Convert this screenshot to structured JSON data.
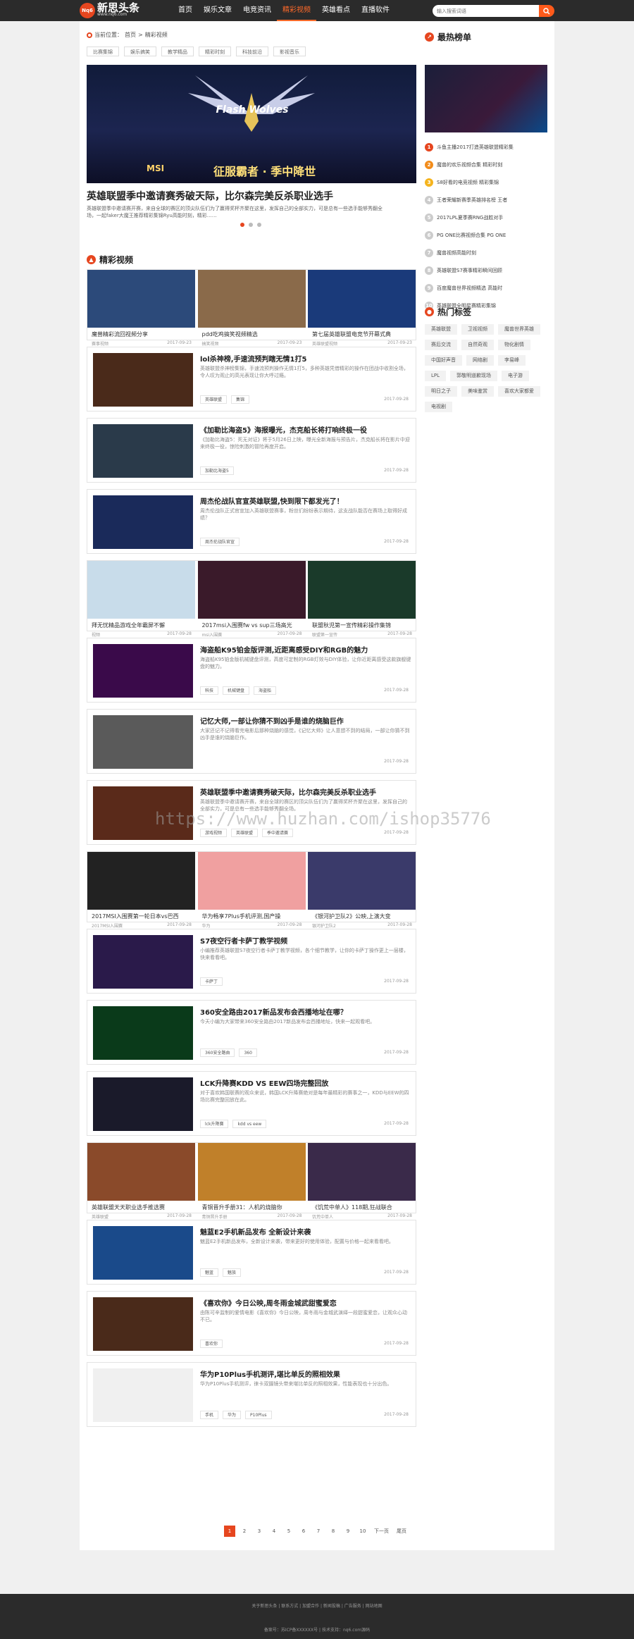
{
  "header": {
    "logo_badge": "Nq6",
    "logo_text": "新思头条",
    "logo_sub": "www.nq6.com",
    "nav": [
      {
        "label": "首页"
      },
      {
        "label": "娱乐文章"
      },
      {
        "label": "电竞资讯"
      },
      {
        "label": "精彩视频",
        "active": true
      },
      {
        "label": "英雄看点"
      },
      {
        "label": "直播软件"
      }
    ],
    "search_placeholder": "输入搜索词语"
  },
  "breadcrumb": {
    "prefix": "当前位置：",
    "home": "首页",
    "sep": " > ",
    "current": "精彩视频"
  },
  "filter_tags": [
    "比赛集锦",
    "娱乐搞笑",
    "教学精品",
    "精彩时刻",
    "科技前沿",
    "影视音乐"
  ],
  "slider": {
    "logo_text": "Flash Wolves",
    "msi": "MSI",
    "slogan": "征服霸者 · 季中降世",
    "title": "英雄联盟季中邀请赛秀破天际，比尔森完美反杀职业选手",
    "desc": "英雄联盟季中邀请赛开赛，来自全球的赛区的顶尖队伍们为了赢得奖杯齐聚在这里，发挥自己的全部实力，可是总有一些选手能够秀翻全场，一起faker大魔王推荐精彩集锦Ryu高能时刻，精彩……"
  },
  "section_title": "精彩视频",
  "cards": [
    {
      "type": "triple",
      "items": [
        {
          "title": "魔兽精彩流回视频分享",
          "tag": "赛事视频",
          "date": "2017-09-23",
          "color": "#2c4a7a"
        },
        {
          "title": "pdd吃鸡搞笑视频精选",
          "tag": "搞笑视频",
          "date": "2017-09-23",
          "color": "#8a6a4a"
        },
        {
          "title": "第七届英雄联盟电竞节开幕式典",
          "tag": "英雄联盟视频",
          "date": "2017-09-23",
          "color": "#1a3a7a"
        }
      ]
    },
    {
      "type": "single",
      "title": "lol杀神榜,手速流预判瞎无情1打5",
      "desc": "英雄联盟杀神榜集锦，手速流预判操作无情1打5，多种英雄凭借精彩的操作在团战中收割全场，令人叹为观止的高光表现让你大呼过瘾。",
      "tags": [
        "英雄联盟",
        "集锦"
      ],
      "date": "2017-09-28",
      "color": "#4a2a1a"
    },
    {
      "type": "single",
      "title": "《加勒比海盗5》海报曝光，杰克船长将打响终极一役",
      "desc": "《加勒比海盗5：死无对证》将于5月26日上映，曝光全新海报与预告片，杰克船长将在影片中迎来终极一役，惊险刺激的冒险再度开启。",
      "tags": [
        "加勒比海盗5"
      ],
      "date": "2017-09-28",
      "color": "#2a3a4a"
    },
    {
      "type": "single",
      "title": "周杰伦战队官宣英雄联盟,快到限下都发光了！",
      "desc": "周杰伦战队正式官宣加入英雄联盟赛事，粉丝们纷纷表示期待，这支战队能否在赛场上取得好成绩？",
      "tags": [
        "周杰伦战队官宣"
      ],
      "date": "2017-09-28",
      "color": "#1a2a5a"
    },
    {
      "type": "triple",
      "items": [
        {
          "title": "拜无忧精品游戏全年霸屏不懈",
          "tag": "视频",
          "date": "2017-09-28",
          "color": "#c8dcea"
        },
        {
          "title": "2017msi入围赛fw vs sup三场高光",
          "tag": "msi入围赛",
          "date": "2017-09-28",
          "color": "#3a1a2a"
        },
        {
          "title": "联盟秋児第一宣传精彩操作集锦",
          "tag": "联盟第一宣传",
          "date": "2017-09-28",
          "color": "#1a3a2a"
        }
      ]
    },
    {
      "type": "single",
      "title": "海盗船K95铂金版评测,近距离感受DIY和RGB的魅力",
      "desc": "海盗船K95铂金版机械键盘评测，高度可定制的RGB灯效与DIY体验，让你近距离感受这款旗舰键盘的魅力。",
      "tags": [
        "科技",
        "机械键盘",
        "海盗船"
      ],
      "date": "2017-09-28",
      "color": "#3a0a4a"
    },
    {
      "type": "single",
      "title": "记忆大师,一部让你猜不到凶手是谁的烧脑巨作",
      "desc": "大家还记不记得看完电影后那种烧脑的感觉，《记忆大师》让人意想不到的结局，一部让你猜不到凶手是谁的烧脑巨作。",
      "tags": [],
      "date": "2017-09-28",
      "color": "#5a5a5a"
    },
    {
      "type": "single",
      "title": "英雄联盟季中邀请赛秀破天际，比尔森完美反杀职业选手",
      "desc": "英雄联盟季中邀请赛开赛，来自全球的赛区的顶尖队伍们为了赢得奖杯齐聚在这里，发挥自己的全部实力，可是总有一些选手能够秀翻全场。",
      "tags": [
        "游戏视频",
        "英雄联盟",
        "季中邀请赛"
      ],
      "date": "2017-09-28",
      "color": "#5a2a1a"
    },
    {
      "type": "triple",
      "items": [
        {
          "title": "2017MSI入围赛第一轮日本vs巴西",
          "tag": "2017MSI入围赛",
          "date": "2017-09-28",
          "color": "#222222"
        },
        {
          "title": "华为畅享7Plus手机评测,国产操",
          "tag": "华为",
          "date": "2017-09-28",
          "color": "#f0a0a0"
        },
        {
          "title": "《银河护卫队2》公映,上演大变",
          "tag": "银河护卫队2",
          "date": "2017-09-28",
          "color": "#3a3a6a"
        }
      ]
    },
    {
      "type": "single",
      "title": "S7夜空行者卡萨丁教学视频",
      "desc": "小编推荐英雄联盟S7夜空行者卡萨丁教学视频，各个细节教学，让你的卡萨丁操作更上一层楼，快来看看吧。",
      "tags": [
        "卡萨丁"
      ],
      "date": "2017-09-28",
      "color": "#2a1a4a"
    },
    {
      "type": "single",
      "title": "360安全路由2017新品发布会西播地址在哪？",
      "desc": "今天小编为大家带来360安全路由2017新品发布会西播地址，快来一起观看吧。",
      "tags": [
        "360安全路由",
        "360"
      ],
      "date": "2017-09-28",
      "color": "#0a3a1a"
    },
    {
      "type": "single",
      "title": "LCK升降赛KDD VS EEW四场完整回放",
      "desc": "对于喜欢韩国联赛的观众来说，韩国LCK升降赛绝对是每年最精彩的赛事之一，KDD与EEW的四场比赛完整回放在此。",
      "tags": [
        "lck升降赛",
        "kdd vs eew"
      ],
      "date": "2017-09-28",
      "color": "#1a1a2a"
    },
    {
      "type": "triple",
      "items": [
        {
          "title": "英雄联盟天天职业选手推选赛",
          "tag": "英雄联盟",
          "date": "2017-09-28",
          "color": "#8a4a2a"
        },
        {
          "title": "青铜晋升手册31：人机的烧脑你",
          "tag": "青铜晋升手册",
          "date": "2017-09-28",
          "color": "#c0802a"
        },
        {
          "title": "《饥荒中单人》118期,狂战联合",
          "tag": "饥荒中单人",
          "date": "2017-09-28",
          "color": "#3a2a4a"
        }
      ]
    },
    {
      "type": "single",
      "title": "魅蓝E2手机新品发布 全新设计来袭",
      "desc": "魅蓝E2手机新品发布，全新设计来袭，带来更好的使用体验，配置与价格一起来看看吧。",
      "tags": [
        "魅蓝",
        "魅族"
      ],
      "date": "2017-09-28",
      "color": "#1a4a8a"
    },
    {
      "type": "single",
      "title": "《喜欢你》今日公映,周冬雨金城武甜蜜爱恋",
      "desc": "由陈可辛监制的爱情电影《喜欢你》今日公映，周冬雨与金城武演绎一段甜蜜爱恋，让观众心动不已。",
      "tags": [
        "喜欢你"
      ],
      "date": "2017-09-28",
      "color": "#4a2a1a"
    },
    {
      "type": "single",
      "title": "华为P10Plus手机测评,堪比单反的照相效果",
      "desc": "华为P10Plus手机测评，徕卡双摄镜头带来堪比单反的照相效果，性能表现也十分出色。",
      "tags": [
        "手机",
        "华为",
        "P10Plus"
      ],
      "date": "2017-09-28",
      "color": "#f0f0f0"
    }
  ],
  "sidebar": {
    "hot_title": "最热榜单",
    "hot_list": [
      "斗鱼主播2017打造英雄联盟精彩集",
      "魔兽的欢乐视频合集 精彩时刻",
      "S8好看的电竞视频 精彩集锦",
      "王者荣耀新赛季英雄排名榜 王者",
      "2017LPL夏季赛RNG战胜对手",
      "PG ONE比赛视频合集 PG ONE",
      "魔兽视频高能时刻",
      "英雄联盟S7赛事精彩瞬间回顾",
      "百度魔兽世界视频精选 高能时",
      "英雄联盟全明星赛精彩集锦"
    ],
    "tags_title": "热门标签",
    "tags": [
      "英雄联盟",
      "卫视视频",
      "魔兽世界英雄",
      "赛后交流",
      "自然奇观",
      "物化剧情",
      "中国好声音",
      "网络剧",
      "李易峰",
      "LPL",
      "郭敬明道歉现场",
      "电子游",
      "明日之子",
      "美味鉴赏",
      "喜欢大家都爱",
      "电视剧"
    ]
  },
  "pager": [
    "1",
    "2",
    "3",
    "4",
    "5",
    "6",
    "7",
    "8",
    "9",
    "10",
    "下一页",
    "尾页"
  ],
  "footer": {
    "links": "关于新思头条 | 联系方式 | 加盟合作 | 新闻投稿 | 广告服务 | 网站地图",
    "copy": "备案号：苏ICP备XXXXXX号 | 技术支持：nq6.com源码"
  },
  "watermark": "https://www.huzhan.com/ishop35776"
}
